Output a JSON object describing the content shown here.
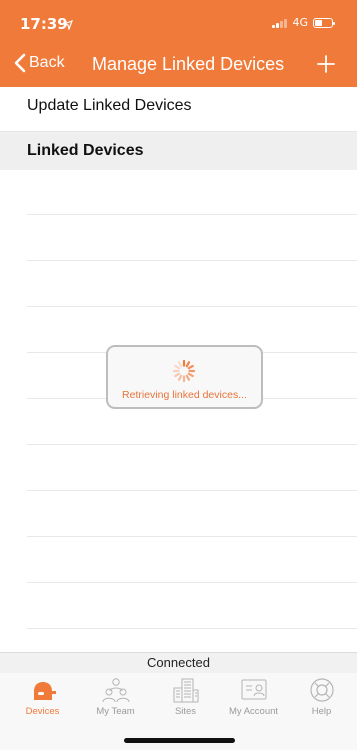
{
  "status_bar": {
    "time": "17:39",
    "network": "4G",
    "battery_level": 0.45
  },
  "nav_bar": {
    "back_label": "Back",
    "title": "Manage Linked Devices",
    "add_icon": "plus-icon"
  },
  "list": {
    "update_row_label": "Update Linked Devices",
    "section_header": "Linked Devices"
  },
  "loading": {
    "message": "Retrieving linked devices..."
  },
  "connection": {
    "status": "Connected"
  },
  "tab_bar": {
    "items": [
      {
        "label": "Devices",
        "icon": "devices-icon",
        "active": true
      },
      {
        "label": "My Team",
        "icon": "team-icon",
        "active": false
      },
      {
        "label": "Sites",
        "icon": "sites-icon",
        "active": false
      },
      {
        "label": "My Account",
        "icon": "account-icon",
        "active": false
      },
      {
        "label": "Help",
        "icon": "help-icon",
        "active": false
      }
    ]
  },
  "colors": {
    "accent": "#f07a3a",
    "inactive_tab": "#9b9b9b",
    "section_background": "#efefef"
  }
}
